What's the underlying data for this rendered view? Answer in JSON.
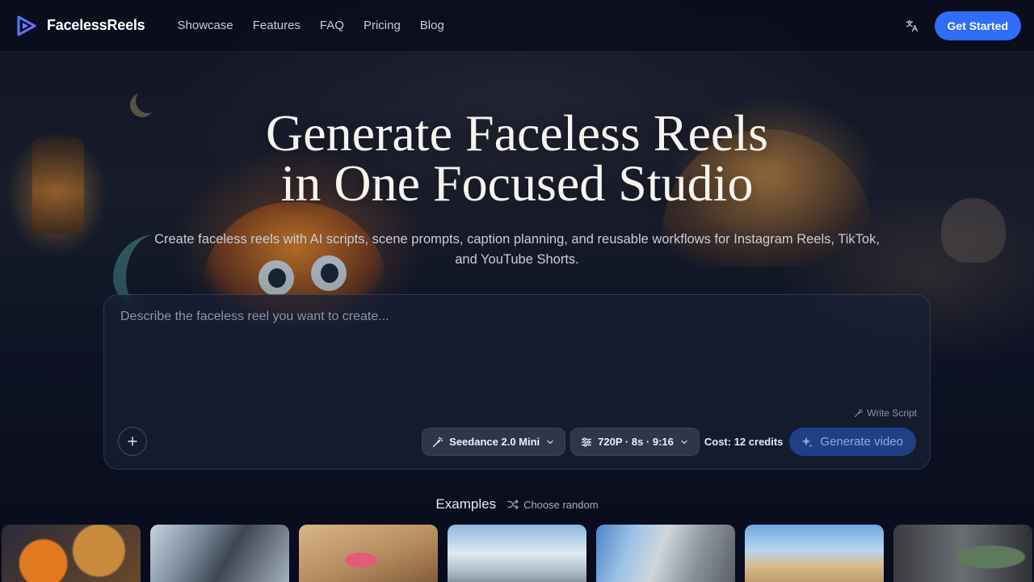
{
  "header": {
    "brand": "FacelessReels",
    "nav": [
      {
        "label": "Showcase"
      },
      {
        "label": "Features"
      },
      {
        "label": "FAQ"
      },
      {
        "label": "Pricing"
      },
      {
        "label": "Blog"
      }
    ],
    "language_icon": "translate-icon",
    "cta_label": "Get Started"
  },
  "hero": {
    "title_line1": "Generate Faceless Reels",
    "title_line2": "in One Focused Studio",
    "subtitle": "Create faceless reels with AI scripts, scene prompts, caption planning, and reusable workflows for Instagram Reels, TikTok, and YouTube Shorts."
  },
  "composer": {
    "placeholder": "Describe the faceless reel you want to create...",
    "write_script_label": "Write Script",
    "model_label": "Seedance 2.0 Mini",
    "settings_label": "720P · 8s · 9:16",
    "cost_label": "Cost: 12 credits",
    "generate_label": "Generate video"
  },
  "examples": {
    "title": "Examples",
    "random_label": "Choose random",
    "count_visible": 7
  },
  "colors": {
    "accent": "#2f6df6",
    "generate_button_bg": "#1f3f86",
    "header_bg": "#090d1c"
  }
}
